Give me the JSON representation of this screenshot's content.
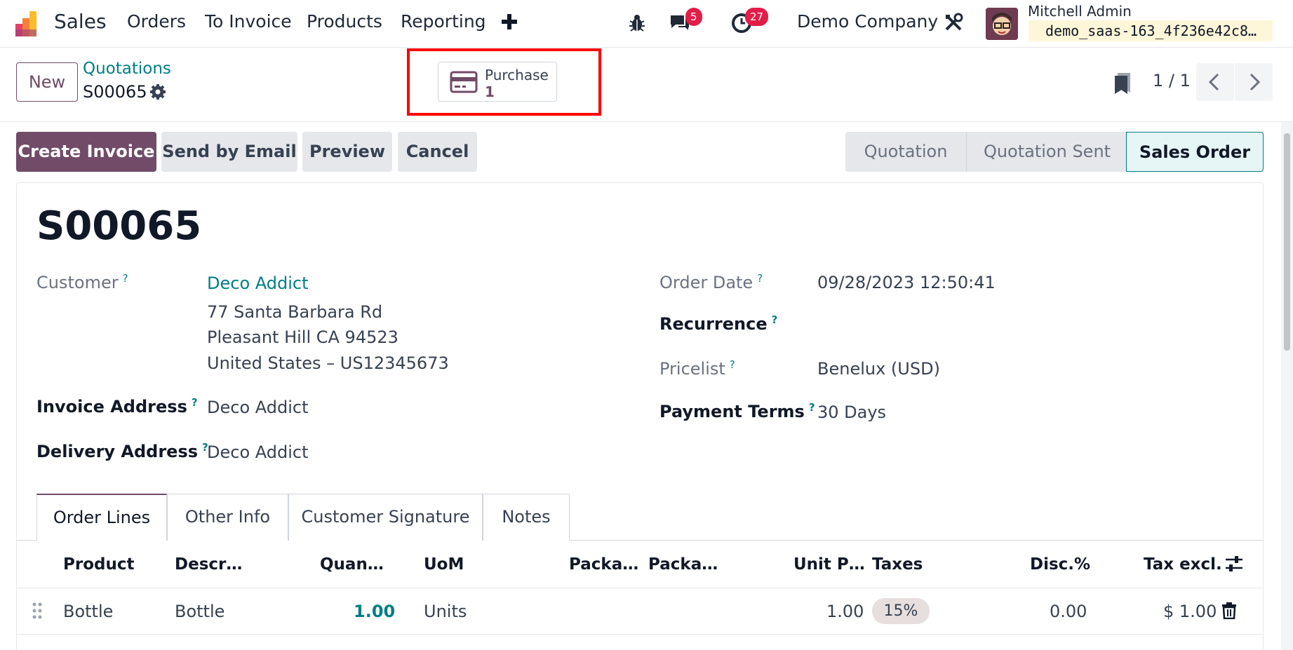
{
  "nav": {
    "app_name": "Sales",
    "menu": [
      "Orders",
      "To Invoice",
      "Products",
      "Reporting"
    ],
    "messages_badge": "5",
    "activities_badge": "27",
    "company": "Demo Company",
    "user_name": "Mitchell Admin",
    "db_name": "demo_saas-163_4f236e42c8…"
  },
  "control": {
    "new_label": "New",
    "breadcrumb_parent": "Quotations",
    "record_name": "S00065",
    "smart_button": {
      "label": "Purchase",
      "count": "1"
    },
    "pager": "1 / 1"
  },
  "actions": {
    "create_invoice": "Create Invoice",
    "send_email": "Send by Email",
    "preview": "Preview",
    "cancel": "Cancel"
  },
  "status": {
    "stages": [
      "Quotation",
      "Quotation Sent",
      "Sales Order"
    ],
    "active": "Sales Order"
  },
  "form": {
    "title": "S00065",
    "customer_label": "Customer",
    "customer_name": "Deco Addict",
    "address_line1": "77 Santa Barbara Rd",
    "address_line2": "Pleasant Hill CA 94523",
    "address_line3": "United States – US12345673",
    "invoice_address_label": "Invoice Address",
    "invoice_address": "Deco Addict",
    "delivery_address_label": "Delivery Address",
    "delivery_address": "Deco Addict",
    "order_date_label": "Order Date",
    "order_date": "09/28/2023 12:50:41",
    "recurrence_label": "Recurrence",
    "pricelist_label": "Pricelist",
    "pricelist": "Benelux (USD)",
    "payment_terms_label": "Payment Terms",
    "payment_terms": "30 Days",
    "help_mark": "?"
  },
  "tabs": [
    "Order Lines",
    "Other Info",
    "Customer Signature",
    "Notes"
  ],
  "table": {
    "headers": [
      "Product",
      "Descr…",
      "Quan…",
      "UoM",
      "Packa…",
      "Packa…",
      "Unit P…",
      "Taxes",
      "Disc.%",
      "Tax excl."
    ],
    "rows": [
      {
        "product": "Bottle",
        "description": "Bottle",
        "quantity": "1.00",
        "uom": "Units",
        "unit_price": "1.00",
        "taxes": "15%",
        "discount": "0.00",
        "subtotal": "$ 1.00"
      }
    ]
  },
  "colors": {
    "brand": "#714b67",
    "link": "#017e84",
    "highlight": "#ff0000"
  }
}
